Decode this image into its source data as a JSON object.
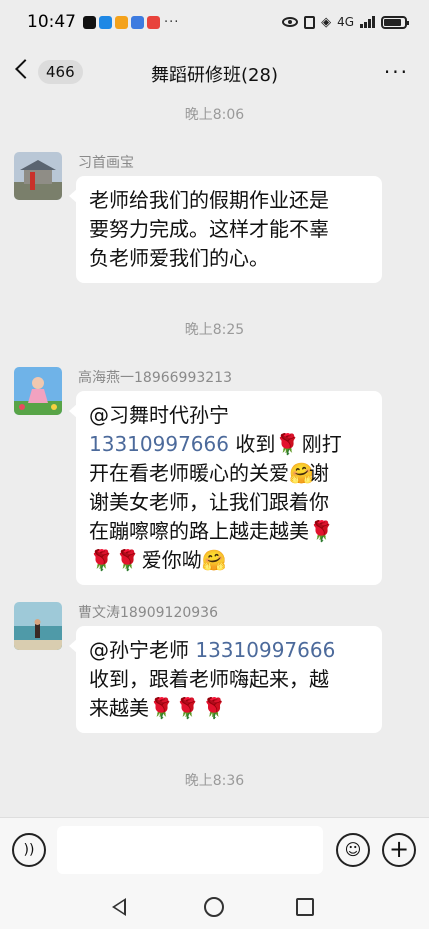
{
  "status": {
    "time": "10:47",
    "more": "···",
    "net": "4G"
  },
  "header": {
    "back_count": "466",
    "title": "舞蹈研修班(28)",
    "more": "···"
  },
  "timestamps": [
    "晚上8:06",
    "晚上8:25",
    "晚上8:36"
  ],
  "messages": [
    {
      "sender": "习首画宝",
      "lines": [
        "老师给我们的假期作业还是",
        "要努力完成。这样才能不辜",
        "负老师爱我们的心。"
      ]
    },
    {
      "sender": "高海燕一18966993213",
      "l1": "@习舞时代孙宁",
      "phone": "13310997666",
      "l2b": "收到",
      "rose": "🌹",
      "l2c": "刚打",
      "l3a": "开在看老师暖心的关爱",
      "hug": "🤗",
      "l3b": "谢",
      "l4": "谢美女老师，让我们跟着你",
      "l5": "在蹦嚓嚓的路上越走越美",
      "l6": "爱你呦"
    },
    {
      "sender": "曹文涛18909120936",
      "l1a": "@孙宁老师",
      "phone": "13310997666",
      "l2": "收到，跟着老师嗨起来，越",
      "l3": "来越美"
    }
  ],
  "input": {
    "placeholder": ""
  }
}
